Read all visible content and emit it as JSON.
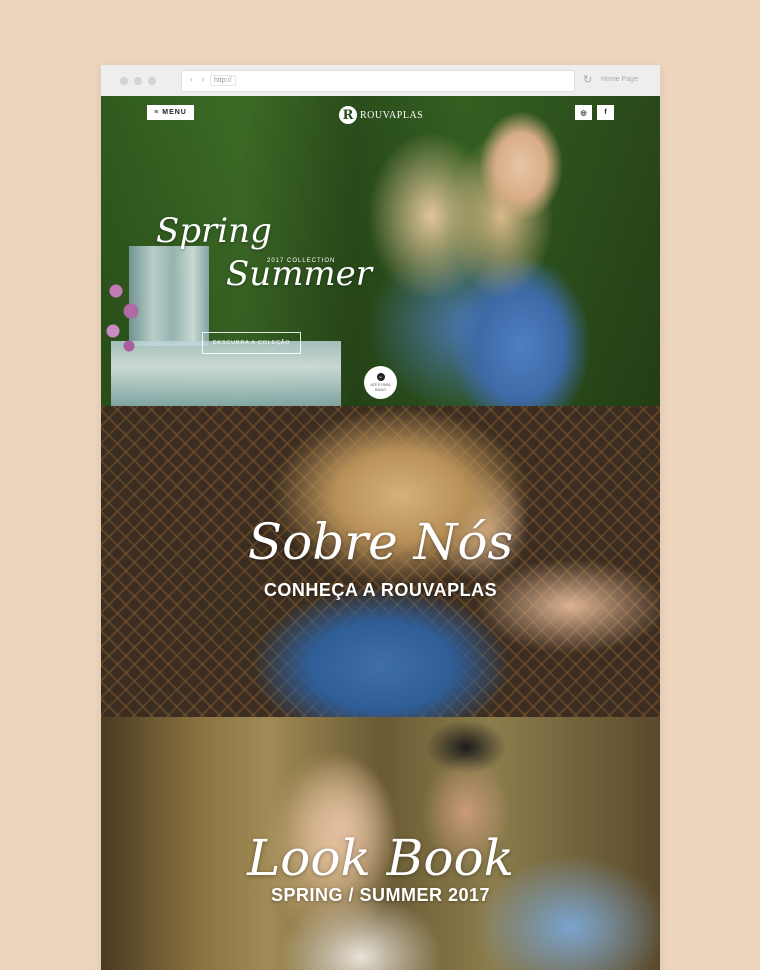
{
  "browser": {
    "nav_arrows": "‹ ›",
    "url": "http://",
    "reload_icon": "reload-icon",
    "tab_title": "Home Page"
  },
  "header": {
    "menu_label": "MENU",
    "menu_icon": "≡",
    "brand": "ROUVAPLAS",
    "brand_mark": "R",
    "social": {
      "instagram": "◎",
      "facebook": "f"
    }
  },
  "hero": {
    "title_line1": "Spring",
    "title_line2": "Summer",
    "collection": "2017 COLLECTION",
    "cta": "DESCUBRA A COLEÇÃO",
    "scroll_text": "ATÉ É PARA BAIXO",
    "scroll_icon": "⌄"
  },
  "about": {
    "title": "Sobre Nós",
    "subtitle": "CONHEÇA A ROUVAPLAS"
  },
  "lookbook": {
    "title": "Look Book",
    "subtitle": "SPRING / SUMMER 2017"
  }
}
